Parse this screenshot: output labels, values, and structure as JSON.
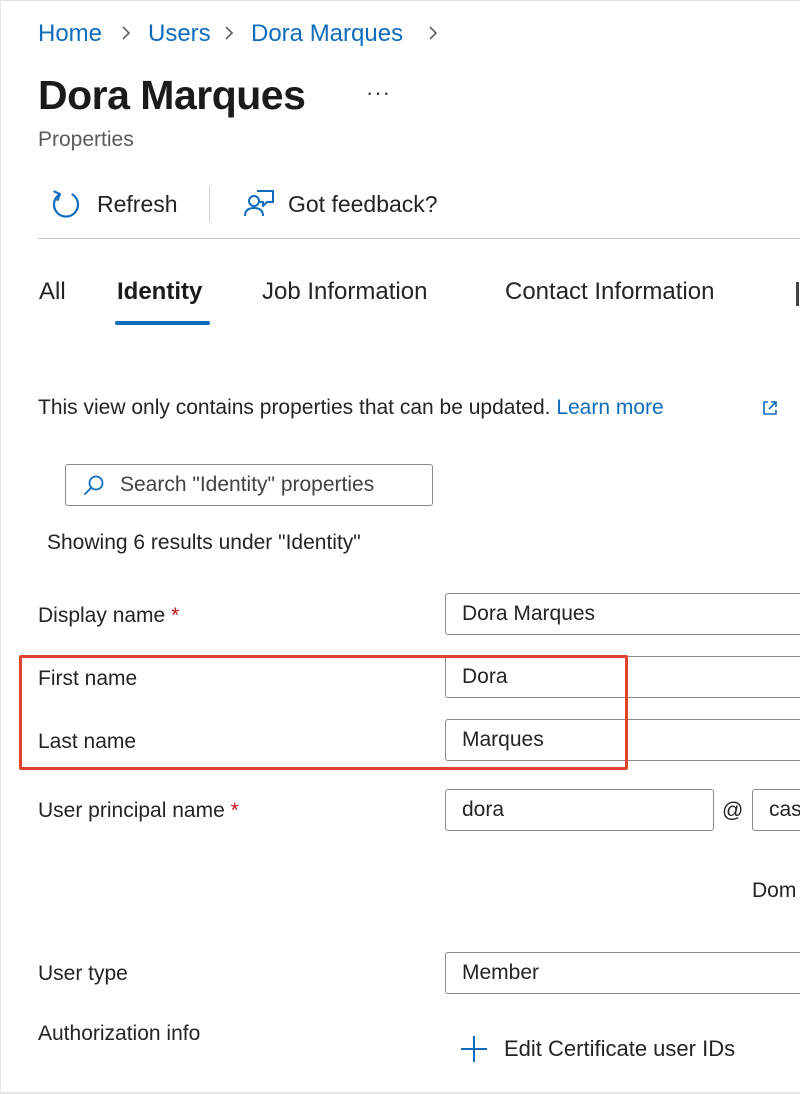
{
  "breadcrumb": {
    "items": [
      "Home",
      "Users",
      "Dora Marques"
    ]
  },
  "header": {
    "title": "Dora Marques",
    "more_label": "···",
    "subtitle": "Properties"
  },
  "toolbar": {
    "refresh_label": "Refresh",
    "feedback_label": "Got feedback?"
  },
  "tabs": [
    {
      "label": "All",
      "active": false
    },
    {
      "label": "Identity",
      "active": true
    },
    {
      "label": "Job Information",
      "active": false
    },
    {
      "label": "Contact Information",
      "active": false
    }
  ],
  "info": {
    "text": "This view only contains properties that can be updated.",
    "link_label": "Learn more"
  },
  "search": {
    "placeholder": "Search \"Identity\" properties",
    "results_text": "Showing 6 results under \"Identity\""
  },
  "form": {
    "display_name": {
      "label": "Display name",
      "required_mark": "*",
      "value": "Dora Marques"
    },
    "first_name": {
      "label": "First name",
      "value": "Dora"
    },
    "last_name": {
      "label": "Last name",
      "value": "Marques"
    },
    "upn": {
      "label": "User principal name",
      "required_mark": "*",
      "value": "dora",
      "at": "@",
      "domain_value": "cas"
    },
    "domain_hint": "Dom",
    "user_type": {
      "label": "User type",
      "value": "Member"
    },
    "authorization": {
      "label": "Authorization info",
      "action_label": "Edit Certificate user IDs"
    }
  },
  "colors": {
    "accent": "#0f6cbd",
    "highlight": "#e0432e",
    "required": "#c50f1f"
  },
  "icons": {
    "refresh": "refresh-icon",
    "feedback": "feedback-icon",
    "external": "external-link-icon",
    "search": "search-icon",
    "add": "plus-icon",
    "chevron": "chevron-right-icon"
  }
}
